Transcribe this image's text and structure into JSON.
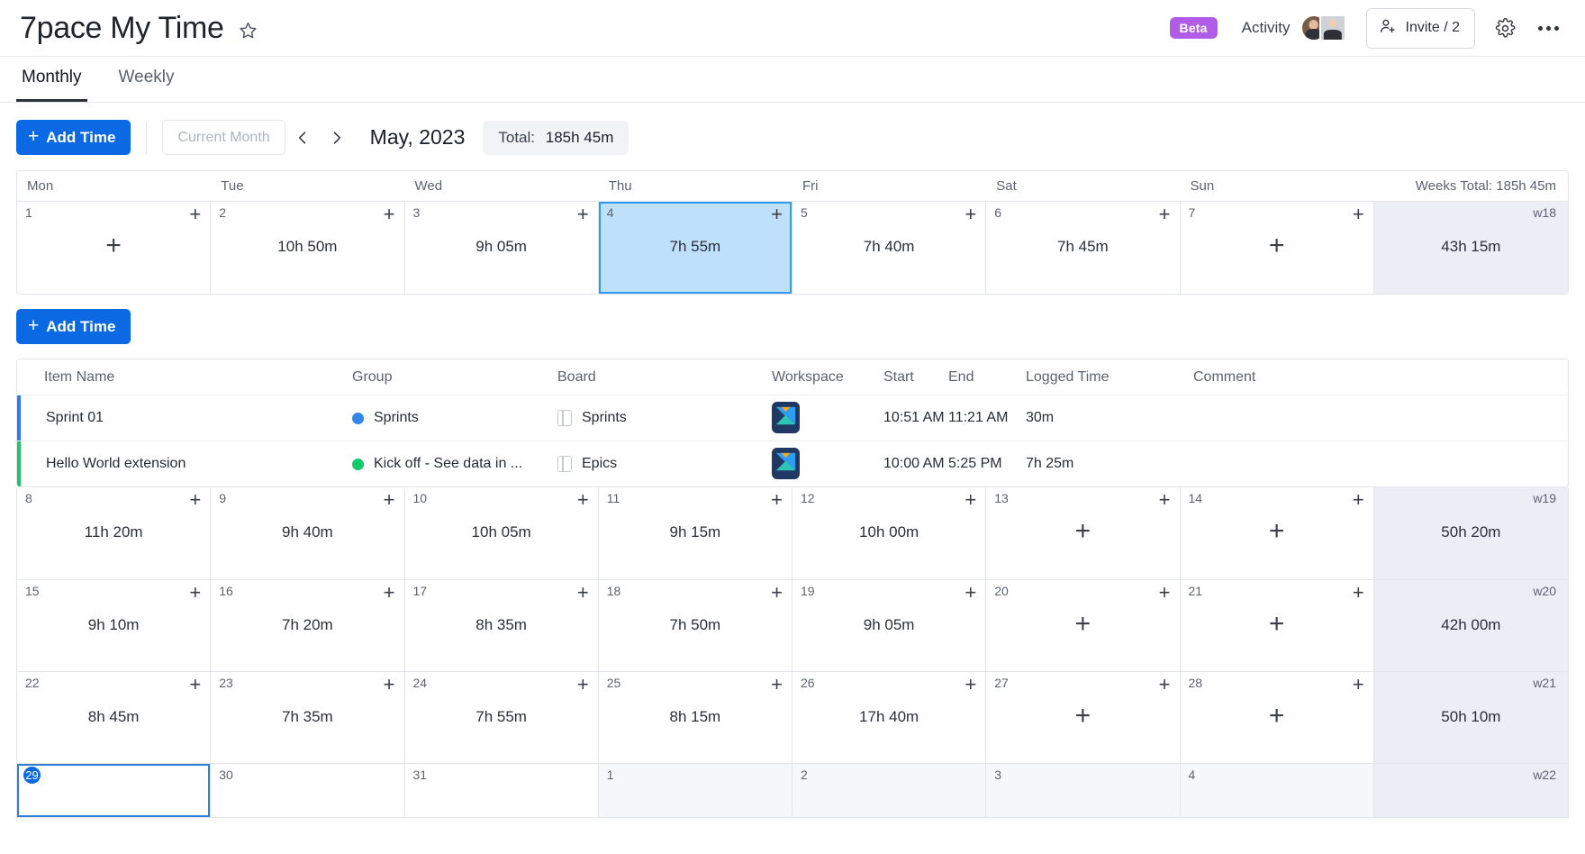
{
  "header": {
    "title": "7pace My Time",
    "star_icon": "star-icon",
    "beta_badge": "Beta",
    "activity_label": "Activity",
    "invite_label": "Invite / 2",
    "settings_icon": "gear-icon",
    "more_icon": "more-options-icon"
  },
  "tabs": [
    {
      "label": "Monthly",
      "active": true
    },
    {
      "label": "Weekly",
      "active": false
    }
  ],
  "toolbar": {
    "add_time_label": "Add Time",
    "current_month_label": "Current Month",
    "prev_icon": "chevron-left-icon",
    "next_icon": "chevron-right-icon",
    "month_label": "May, 2023",
    "total_label": "Total:",
    "total_value": "185h 45m"
  },
  "calendar": {
    "weekday_headers": [
      "Mon",
      "Tue",
      "Wed",
      "Thu",
      "Fri",
      "Sat",
      "Sun"
    ],
    "weeks_total_label": "Weeks Total: 185h 45m",
    "weeks": [
      {
        "week_label": "w18",
        "week_total": "43h 15m",
        "days": [
          {
            "num": "1",
            "duration": "",
            "state": "empty"
          },
          {
            "num": "2",
            "duration": "10h 50m",
            "state": "normal"
          },
          {
            "num": "3",
            "duration": "9h 05m",
            "state": "normal"
          },
          {
            "num": "4",
            "duration": "7h 55m",
            "state": "selected"
          },
          {
            "num": "5",
            "duration": "7h 40m",
            "state": "normal"
          },
          {
            "num": "6",
            "duration": "7h 45m",
            "state": "normal"
          },
          {
            "num": "7",
            "duration": "",
            "state": "empty"
          }
        ]
      },
      {
        "week_label": "w19",
        "week_total": "50h 20m",
        "days": [
          {
            "num": "8",
            "duration": "11h 20m",
            "state": "normal"
          },
          {
            "num": "9",
            "duration": "9h 40m",
            "state": "normal"
          },
          {
            "num": "10",
            "duration": "10h 05m",
            "state": "normal"
          },
          {
            "num": "11",
            "duration": "9h 15m",
            "state": "normal"
          },
          {
            "num": "12",
            "duration": "10h 00m",
            "state": "normal"
          },
          {
            "num": "13",
            "duration": "",
            "state": "empty"
          },
          {
            "num": "14",
            "duration": "",
            "state": "empty"
          }
        ]
      },
      {
        "week_label": "w20",
        "week_total": "42h 00m",
        "days": [
          {
            "num": "15",
            "duration": "9h 10m",
            "state": "normal"
          },
          {
            "num": "16",
            "duration": "7h 20m",
            "state": "normal"
          },
          {
            "num": "17",
            "duration": "8h 35m",
            "state": "normal"
          },
          {
            "num": "18",
            "duration": "7h 50m",
            "state": "normal"
          },
          {
            "num": "19",
            "duration": "9h 05m",
            "state": "normal"
          },
          {
            "num": "20",
            "duration": "",
            "state": "empty"
          },
          {
            "num": "21",
            "duration": "",
            "state": "empty"
          }
        ]
      },
      {
        "week_label": "w21",
        "week_total": "50h 10m",
        "days": [
          {
            "num": "22",
            "duration": "8h 45m",
            "state": "normal"
          },
          {
            "num": "23",
            "duration": "7h 35m",
            "state": "normal"
          },
          {
            "num": "24",
            "duration": "7h 55m",
            "state": "normal"
          },
          {
            "num": "25",
            "duration": "8h 15m",
            "state": "normal"
          },
          {
            "num": "26",
            "duration": "17h 40m",
            "state": "normal"
          },
          {
            "num": "27",
            "duration": "",
            "state": "empty"
          },
          {
            "num": "28",
            "duration": "",
            "state": "empty"
          }
        ]
      },
      {
        "week_label": "w22",
        "week_total": "",
        "days": [
          {
            "num": "29",
            "duration": "",
            "state": "today"
          },
          {
            "num": "30",
            "duration": "",
            "state": "plainrow"
          },
          {
            "num": "31",
            "duration": "",
            "state": "plainrow"
          },
          {
            "num": "1",
            "duration": "",
            "state": "othermonth"
          },
          {
            "num": "2",
            "duration": "",
            "state": "othermonth"
          },
          {
            "num": "3",
            "duration": "",
            "state": "othermonth"
          },
          {
            "num": "4",
            "duration": "",
            "state": "othermonth"
          }
        ]
      }
    ]
  },
  "detail": {
    "add_time_label": "Add Time",
    "columns": [
      "Item Name",
      "Group",
      "Board",
      "Workspace",
      "Start",
      "End",
      "Logged Time",
      "Comment"
    ],
    "rows": [
      {
        "stripe_color": "#2b7cf0",
        "item_name": "Sprint 01",
        "group_dot_color": "#2f86eb",
        "group": "Sprints",
        "board_icon": "board-icon",
        "board": "Sprints",
        "workspace_icon": "workspace-logo-icon",
        "start": "10:51 AM",
        "end": "11:21 AM",
        "logged_time": "30m",
        "comment": ""
      },
      {
        "stripe_color": "#21c36b",
        "item_name": "Hello World extension",
        "group_dot_color": "#12c96b",
        "group": "Kick off - See data in ...",
        "board_icon": "board-icon",
        "board": "Epics",
        "workspace_icon": "workspace-logo-icon",
        "start": "10:00 AM",
        "end": "5:25 PM",
        "logged_time": "7h 25m",
        "comment": ""
      }
    ]
  },
  "colors": {
    "accent": "#0b6ae3",
    "beta": "#b05ce6",
    "selected_cell": "#bfe0fb",
    "week_summary": "#eceef6"
  }
}
